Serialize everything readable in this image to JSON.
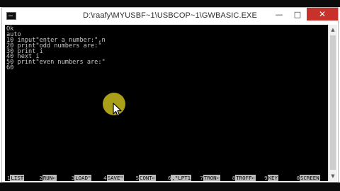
{
  "window": {
    "title": "D:\\raafy\\MYUSBF~1\\USBCOP~1\\GWBASIC.EXE",
    "controls": {
      "minimize": "—",
      "maximize": "□",
      "close": "✕"
    }
  },
  "console": {
    "lines": [
      "Ok",
      "auto",
      "10 input\"enter a number:\",n",
      "20 print\"odd numbers are:\"",
      "30 print i",
      "40 next i",
      "50 print\"even numbers are:\"",
      "60"
    ],
    "function_keys": [
      {
        "num": "1",
        "label": "LIST"
      },
      {
        "num": "2",
        "label": "RUN←"
      },
      {
        "num": "3",
        "label": "LOAD\""
      },
      {
        "num": "4",
        "label": "SAVE\""
      },
      {
        "num": "5",
        "label": "CONT←"
      },
      {
        "num": "6",
        "label": ",\"LPT1"
      },
      {
        "num": "7",
        "label": "TRON←"
      },
      {
        "num": "8",
        "label": "TROFF←"
      },
      {
        "num": "9",
        "label": "KEY"
      },
      {
        "num": "0",
        "label": "SCREEN"
      }
    ]
  },
  "icons": {
    "app_icon": "console-app-icon",
    "pointer": "mouse-pointer-icon"
  },
  "colors": {
    "console_background": "#000000",
    "console_text": "#c8c8c8",
    "close_button": "#c7322b",
    "cursor_highlight": "#b3a81a"
  }
}
